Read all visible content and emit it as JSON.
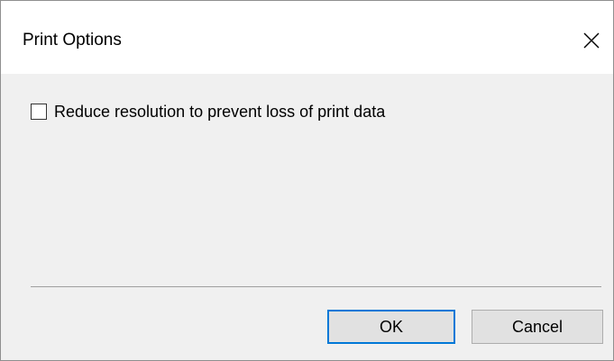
{
  "dialog": {
    "title": "Print Options",
    "close_icon": "close-icon",
    "option": {
      "label": "Reduce resolution to prevent loss of print data",
      "checked": false
    },
    "buttons": {
      "ok_label": "OK",
      "cancel_label": "Cancel"
    }
  },
  "colors": {
    "title_background": "#ffffff",
    "body_background": "#f0f0f0",
    "default_button_border": "#0078d7",
    "button_face": "#e1e1e1"
  }
}
